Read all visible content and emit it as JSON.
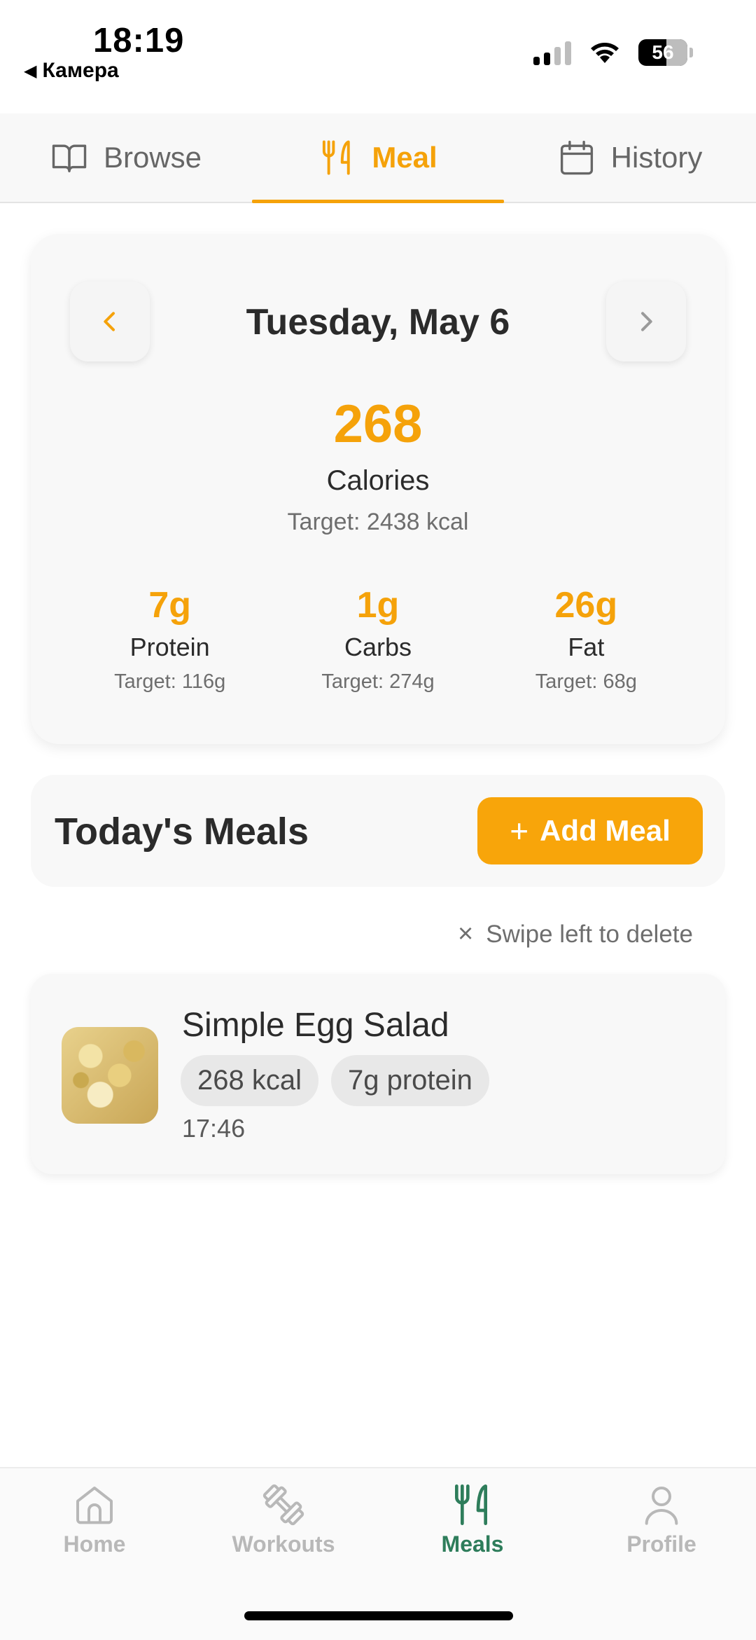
{
  "status_bar": {
    "time": "18:19",
    "back_app": "Камера",
    "battery": "56"
  },
  "top_tabs": [
    {
      "label": "Browse",
      "icon": "book-icon"
    },
    {
      "label": "Meal",
      "icon": "fork-knife-icon",
      "active": true
    },
    {
      "label": "History",
      "icon": "calendar-icon"
    }
  ],
  "summary": {
    "date": "Tuesday, May 6",
    "calories_value": "268",
    "calories_label": "Calories",
    "calories_target": "Target: 2438 kcal",
    "macros": [
      {
        "value": "7g",
        "label": "Protein",
        "target": "Target: 116g"
      },
      {
        "value": "1g",
        "label": "Carbs",
        "target": "Target: 274g"
      },
      {
        "value": "26g",
        "label": "Fat",
        "target": "Target: 68g"
      }
    ]
  },
  "meals_section": {
    "title": "Today's Meals",
    "add_button": "Add Meal",
    "swipe_hint": "Swipe left to delete"
  },
  "meals": [
    {
      "name": "Simple Egg Salad",
      "kcal": "268 kcal",
      "protein": "7g protein",
      "time": "17:46"
    }
  ],
  "bottom_nav": [
    {
      "label": "Home",
      "icon": "home-icon"
    },
    {
      "label": "Workouts",
      "icon": "dumbbell-icon"
    },
    {
      "label": "Meals",
      "icon": "fork-knife-icon",
      "active": true
    },
    {
      "label": "Profile",
      "icon": "profile-icon"
    }
  ],
  "colors": {
    "accent": "#f5a20a",
    "nav_active": "#2e7d5b",
    "inactive": "#b8b8b8"
  }
}
